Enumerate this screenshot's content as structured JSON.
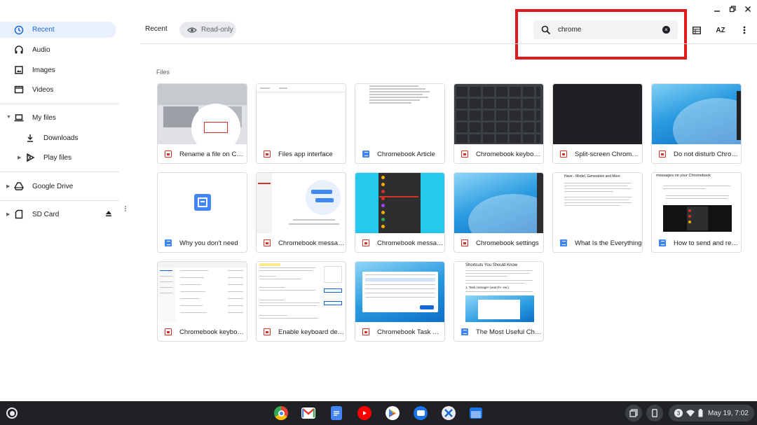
{
  "window": {
    "minimize_label": "minimize",
    "maximize_label": "maximize",
    "close_label": "close"
  },
  "sidebar": {
    "items": [
      {
        "label": "Recent",
        "icon": "clock-icon"
      },
      {
        "label": "Audio",
        "icon": "headphones-icon"
      },
      {
        "label": "Images",
        "icon": "image-icon"
      },
      {
        "label": "Videos",
        "icon": "film-icon"
      },
      {
        "label": "My files",
        "icon": "laptop-icon"
      },
      {
        "label": "Downloads",
        "icon": "download-icon"
      },
      {
        "label": "Play files",
        "icon": "play-store-icon"
      },
      {
        "label": "Google Drive",
        "icon": "drive-icon"
      },
      {
        "label": "SD Card",
        "icon": "sd-card-icon"
      }
    ]
  },
  "header": {
    "title": "Recent",
    "readonly_label": "Read-only"
  },
  "search": {
    "value": "chrome",
    "placeholder": "Search"
  },
  "toolbar": {
    "sort_label": "AZ"
  },
  "files": {
    "section_label": "Files",
    "items": [
      {
        "name": "Rename a file on Chromebook",
        "type": "image"
      },
      {
        "name": "Files app interface",
        "type": "image"
      },
      {
        "name": "Chromebook Article",
        "type": "doc"
      },
      {
        "name": "Chromebook keyboard",
        "type": "image"
      },
      {
        "name": "Split-screen Chromebook",
        "type": "image"
      },
      {
        "name": "Do not disturb Chromebook",
        "type": "image"
      },
      {
        "name": "Why you don't need",
        "type": "doc"
      },
      {
        "name": "Chromebook messages",
        "type": "image"
      },
      {
        "name": "Chromebook messages",
        "type": "image"
      },
      {
        "name": "Chromebook settings",
        "type": "image"
      },
      {
        "name": "What Is the Everything",
        "type": "doc"
      },
      {
        "name": "How to send and receive",
        "type": "doc"
      },
      {
        "name": "Chromebook keyboard",
        "type": "image"
      },
      {
        "name": "Enable keyboard detection",
        "type": "image"
      },
      {
        "name": "Chromebook Task Manager",
        "type": "image"
      },
      {
        "name": "The Most Useful Chromebook",
        "type": "doc"
      }
    ],
    "thumb_texts": {
      "t11_heading": "Have - Model, Generation and More",
      "t12_heading": "messages on your Chromebook",
      "t16_heading": "Shortcuts You Should Know",
      "t16_sub": "1. Task manager (search+ esc)"
    }
  },
  "shelf": {
    "apps": [
      "chrome-icon",
      "gmail-icon",
      "docs-icon",
      "youtube-icon",
      "play-store-icon",
      "messages-icon",
      "settings-icon",
      "files-icon"
    ],
    "notification_count": "3",
    "date_time": "May 19, 7:02"
  },
  "colors": {
    "accent": "#1967d2",
    "active_bg": "#e8f0fe",
    "highlight": "#e01a1a",
    "shelf": "#202124"
  }
}
